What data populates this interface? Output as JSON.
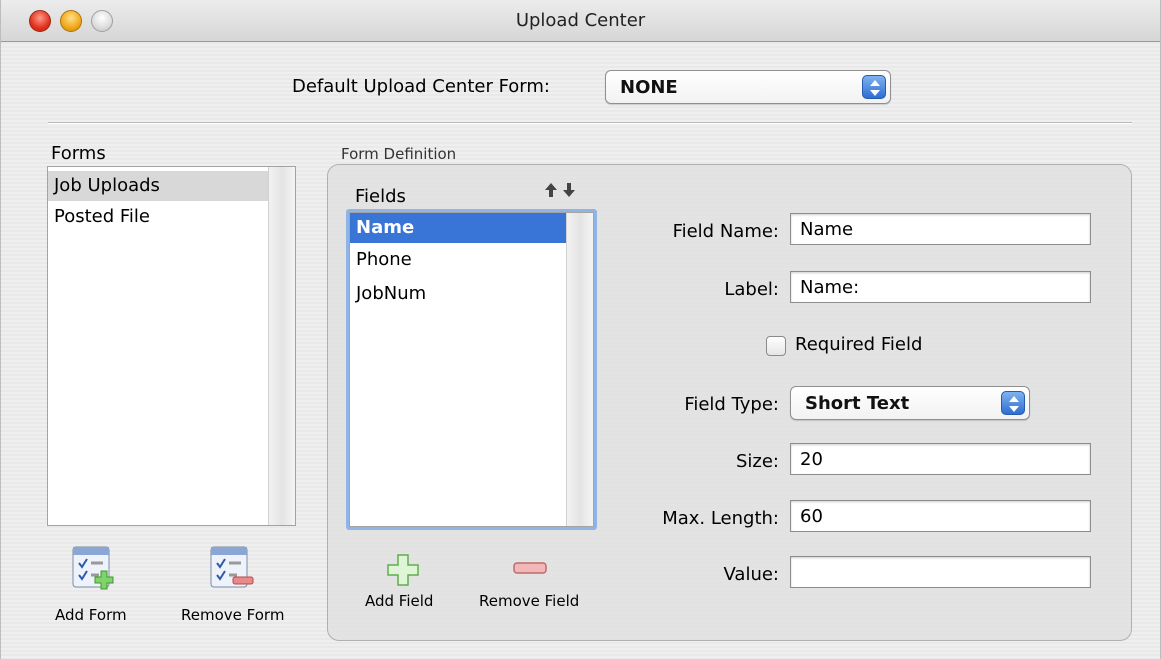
{
  "window": {
    "title": "Upload Center"
  },
  "default_form": {
    "label": "Default Upload Center Form:",
    "value": "NONE"
  },
  "forms": {
    "header": "Forms",
    "items": [
      "Job Uploads",
      "Posted File"
    ],
    "add_label": "Add Form",
    "remove_label": "Remove Form"
  },
  "form_definition": {
    "title": "Form Definition",
    "fields_header": "Fields",
    "fields": [
      "Name",
      "Phone",
      "JobNum"
    ],
    "add_field_label": "Add Field",
    "remove_field_label": "Remove Field"
  },
  "details": {
    "field_name_label": "Field Name:",
    "field_name_value": "Name",
    "label_label": "Label:",
    "label_value": "Name:",
    "required_label": "Required Field",
    "required_checked": false,
    "field_type_label": "Field Type:",
    "field_type_value": "Short Text",
    "size_label": "Size:",
    "size_value": "20",
    "max_length_label": "Max. Length:",
    "max_length_value": "60",
    "value_label": "Value:",
    "value_value": ""
  },
  "colors": {
    "selection_blue": "#3875d7",
    "selection_grey": "#d8d8d8"
  }
}
